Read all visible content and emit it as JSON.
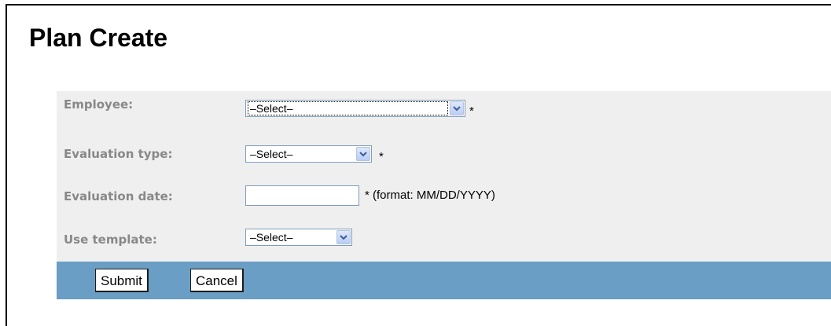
{
  "page": {
    "title": "Plan Create"
  },
  "form": {
    "employee": {
      "label": "Employee:",
      "value": "–Select–",
      "required_mark": "*"
    },
    "evaluation_type": {
      "label": "Evaluation type:",
      "value": "–Select–",
      "required_mark": "*"
    },
    "evaluation_date": {
      "label": "Evaluation date:",
      "value": "",
      "hint": "* (format: MM/DD/YYYY)"
    },
    "use_template": {
      "label": "Use template:",
      "value": "–Select–"
    }
  },
  "buttons": {
    "submit": "Submit",
    "cancel": "Cancel"
  },
  "colors": {
    "panel_bg": "#efefef",
    "button_bar_bg": "#6a9ec5",
    "label_text": "#888888"
  },
  "icons": {
    "dropdown": "chevron-down-icon"
  }
}
